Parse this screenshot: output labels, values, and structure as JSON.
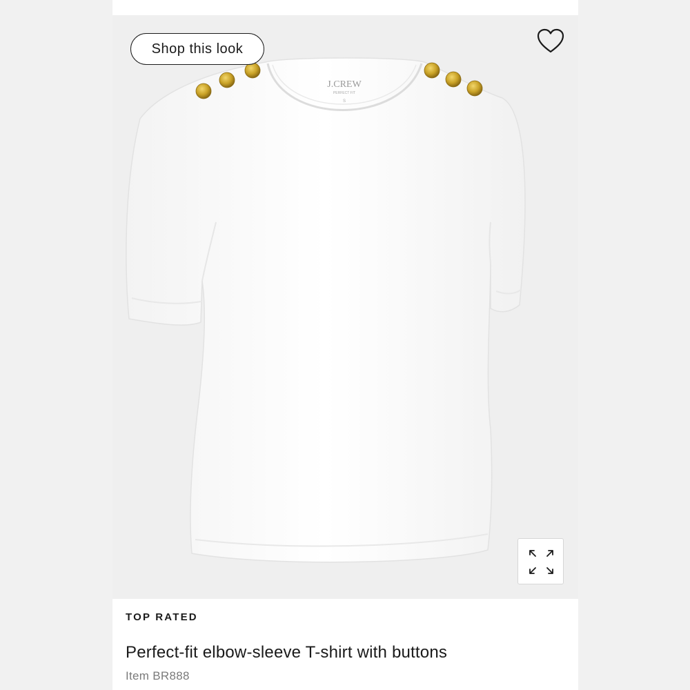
{
  "product": {
    "badge": "TOP RATED",
    "name": "Perfect-fit elbow-sleeve T-shirt with buttons",
    "item_number": "Item BR888",
    "image": {
      "label_brand": "J.CREW",
      "label_fit": "PERFECT FIT",
      "label_size": "S",
      "buttons_per_shoulder": 3
    }
  },
  "actions": {
    "shop_look_label": "Shop this look",
    "favorite_icon": "heart-outline-icon",
    "expand_icon": "expand-arrows-icon"
  },
  "colors": {
    "button_gold": "#c9a227",
    "shirt": "#ffffff",
    "background": "#efefef",
    "text": "#1a1a1a"
  }
}
